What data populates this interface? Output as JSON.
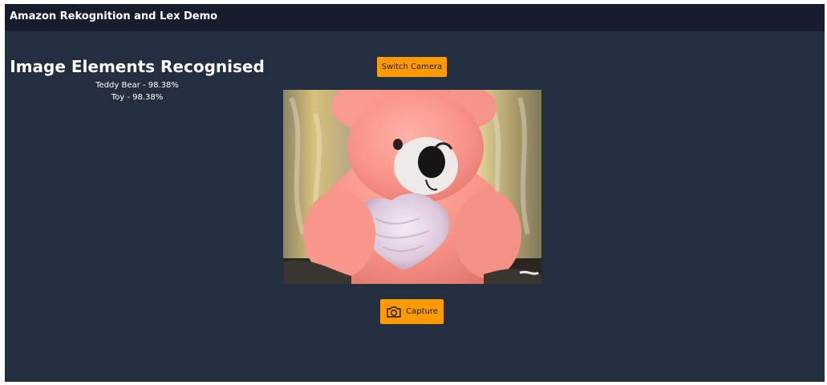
{
  "app": {
    "title": "Amazon Rekognition and Lex Demo"
  },
  "results": {
    "title": "Image Elements Recognised",
    "labels": [
      {
        "text": "Teddy Bear - 98.38%"
      },
      {
        "text": "Toy - 98.38%"
      }
    ]
  },
  "controls": {
    "switch_camera_label": "Switch Camera",
    "capture_label": "Capture",
    "capture_icon": "camera-icon"
  },
  "colors": {
    "header_bg": "#161e2d",
    "page_bg": "#232f3e",
    "accent": "#ff9900"
  }
}
